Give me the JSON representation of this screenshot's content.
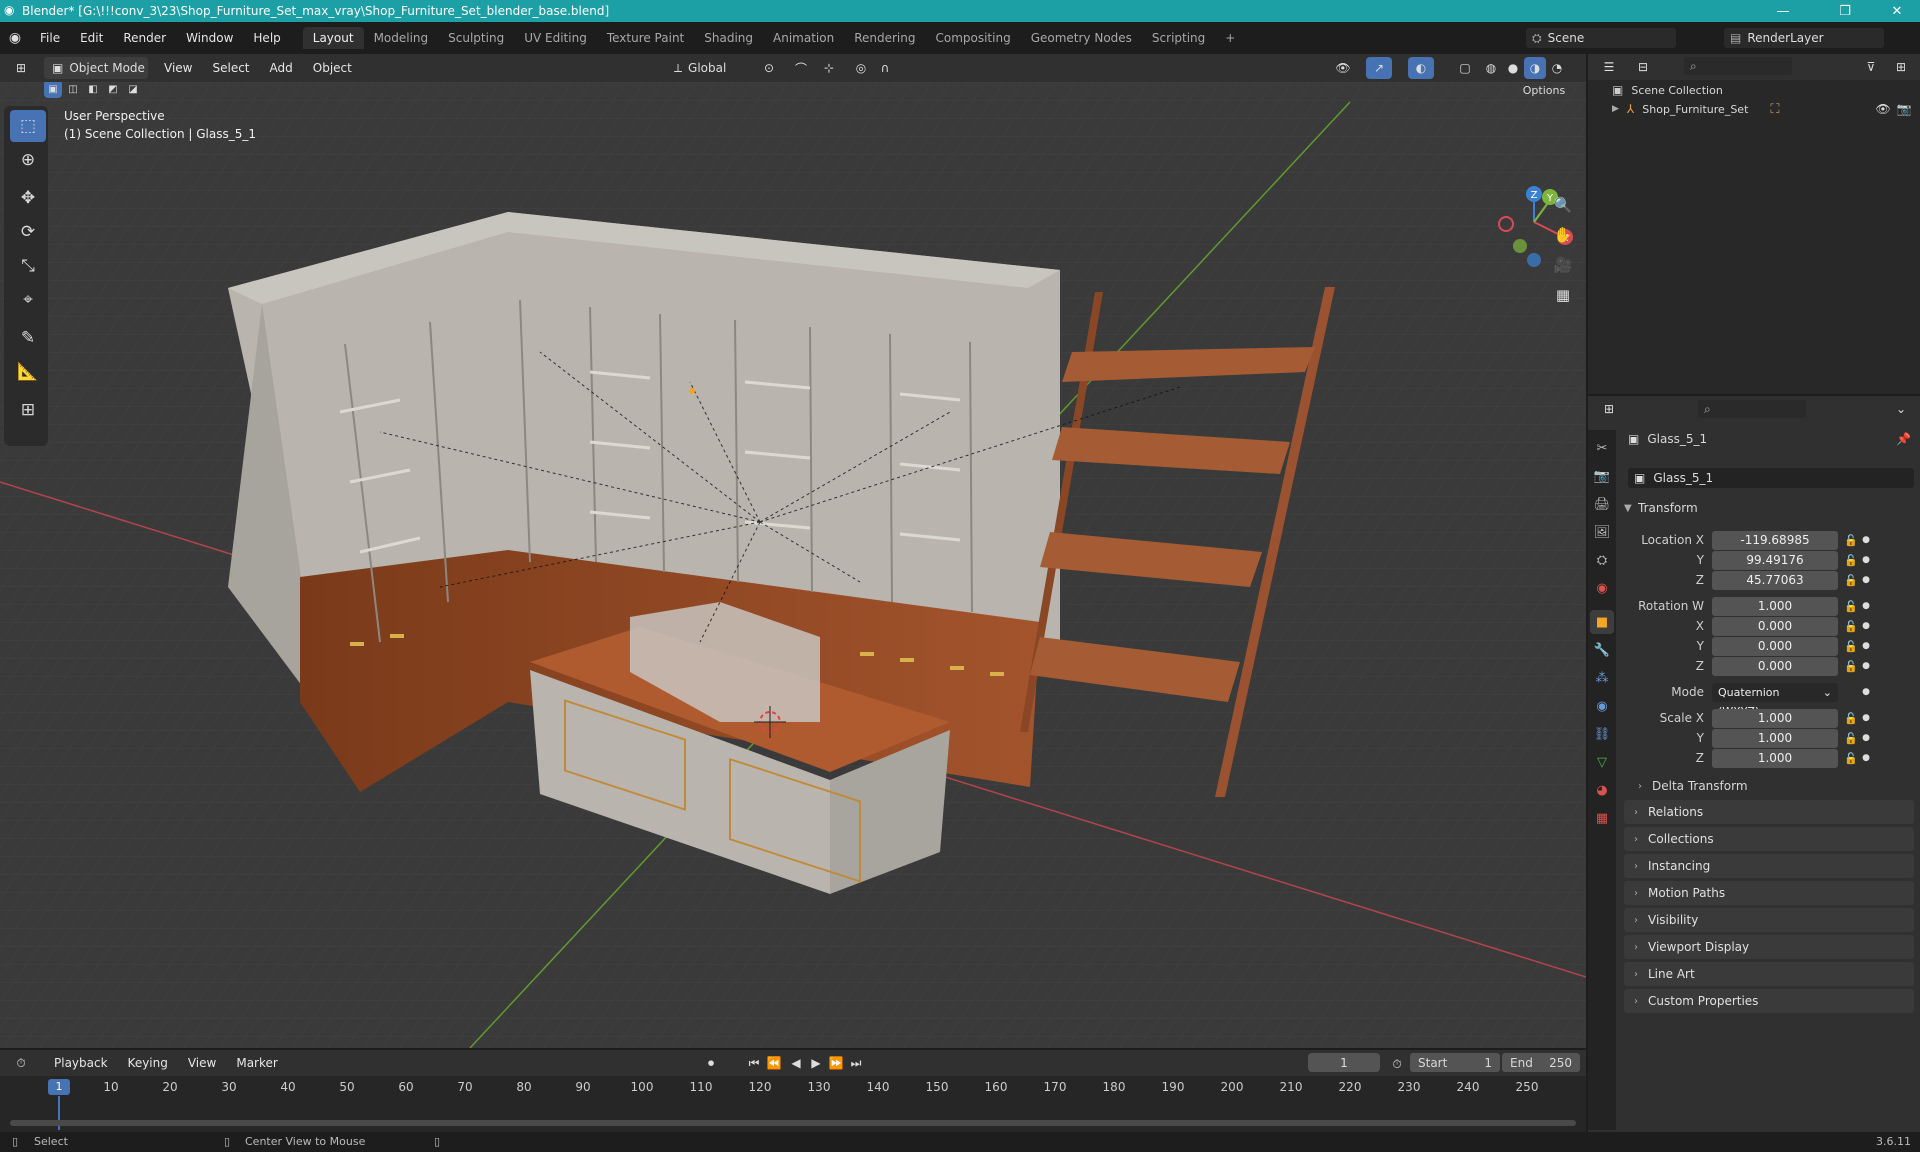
{
  "window": {
    "title": "Blender* [G:\\!!!conv_3\\23\\Shop_Furniture_Set_max_vray\\Shop_Furniture_Set_blender_base.blend]",
    "minimize_glyph": "—",
    "maximize_glyph": "❐",
    "close_glyph": "✕"
  },
  "menus": [
    "File",
    "Edit",
    "Render",
    "Window",
    "Help"
  ],
  "workspaces": [
    "Layout",
    "Modeling",
    "Sculpting",
    "UV Editing",
    "Texture Paint",
    "Shading",
    "Animation",
    "Rendering",
    "Compositing",
    "Geometry Nodes",
    "Scripting"
  ],
  "add_workspace": "+",
  "scene": {
    "label": "Scene",
    "render_layer": "RenderLayer"
  },
  "viewport_header": {
    "mode": "Object Mode",
    "menus": [
      "View",
      "Select",
      "Add",
      "Object"
    ],
    "orientation": "Global",
    "options": "Options"
  },
  "viewport": {
    "perspective": "User Perspective",
    "collection_info": "(1) Scene Collection | Glass_5_1",
    "gizmo_axes": [
      "X",
      "Y",
      "Z"
    ]
  },
  "outliner": {
    "search_placeholder": "",
    "root": "Scene Collection",
    "items": [
      {
        "name": "Shop_Furniture_Set"
      }
    ]
  },
  "properties": {
    "object_name": "Glass_5_1",
    "datablock": "Glass_5_1",
    "transform_panel": "Transform",
    "location": {
      "label_x": "Location X",
      "label_y": "Y",
      "label_z": "Z",
      "x": "-119.68985",
      "y": "99.49176",
      "z": "45.77063"
    },
    "rotation": {
      "label_w": "Rotation W",
      "label_x": "X",
      "label_y": "Y",
      "label_z": "Z",
      "w": "1.000",
      "x": "0.000",
      "y": "0.000",
      "z": "0.000"
    },
    "mode": {
      "label": "Mode",
      "value": "Quaternion (WXYZ)"
    },
    "scale": {
      "label_x": "Scale X",
      "label_y": "Y",
      "label_z": "Z",
      "x": "1.000",
      "y": "1.000",
      "z": "1.000"
    },
    "subpanels": [
      "Delta Transform",
      "Relations",
      "Collections",
      "Instancing",
      "Motion Paths",
      "Visibility",
      "Viewport Display",
      "Line Art",
      "Custom Properties"
    ]
  },
  "timeline": {
    "menus": [
      "Playback",
      "Keying",
      "View",
      "Marker"
    ],
    "current_frame": "1",
    "start_label": "Start",
    "start": "1",
    "end_label": "End",
    "end": "250",
    "ruler": [
      "10",
      "20",
      "30",
      "40",
      "50",
      "60",
      "70",
      "80",
      "90",
      "100",
      "110",
      "120",
      "130",
      "140",
      "150",
      "160",
      "170",
      "180",
      "190",
      "200",
      "210",
      "220",
      "230",
      "240",
      "250"
    ],
    "playhead": "1"
  },
  "statusbar": {
    "left": "Select",
    "middle": "Center View to Mouse",
    "version": "3.6.11"
  },
  "colors": {
    "titlebar": "#1d9fa6",
    "accent": "#4772b3",
    "active_object": "#f5a623",
    "x_axis": "#d94a57",
    "y_axis": "#7db53c",
    "z_axis": "#3b82d6"
  }
}
